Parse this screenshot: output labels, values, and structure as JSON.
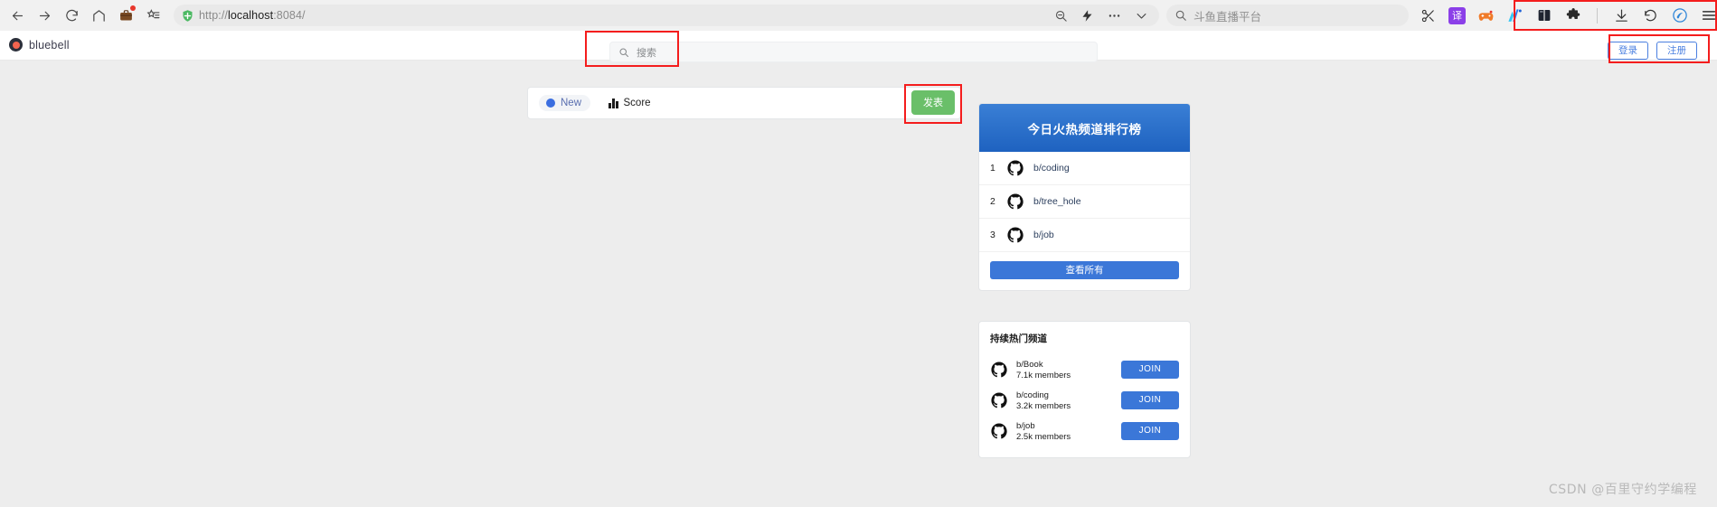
{
  "browser": {
    "nav": [
      {
        "name": "back-icon",
        "label": "Back"
      },
      {
        "name": "forward-icon",
        "label": "Forward"
      },
      {
        "name": "reload-icon",
        "label": "Reload"
      },
      {
        "name": "home-icon",
        "label": "Home"
      },
      {
        "name": "briefcase-icon",
        "label": "Workspace"
      },
      {
        "name": "collections-icon",
        "label": "Collections"
      }
    ],
    "url": {
      "scheme": "http://",
      "host": "localhost",
      "rest": ":8084/"
    },
    "url_icon": "shield-icon",
    "url_actions": [
      {
        "name": "zoom-out-icon",
        "label": "Zoom"
      },
      {
        "name": "flash-icon",
        "label": "Flash"
      },
      {
        "name": "more-icon",
        "label": "More"
      },
      {
        "name": "chevron-down-icon",
        "label": "Expand"
      }
    ],
    "chrome_search": {
      "icon": "search-icon",
      "value": "斗鱼直播平台"
    },
    "extensions": [
      {
        "name": "scissors-icon",
        "label": "Capture"
      },
      {
        "name": "translate-icon",
        "label": "译"
      },
      {
        "name": "game-controller-icon",
        "label": "Games"
      },
      {
        "name": "ai-icon",
        "label": "AI"
      },
      {
        "name": "book-icon",
        "label": "Reading"
      },
      {
        "name": "puzzle-icon",
        "label": "Extensions"
      },
      {
        "name": "download-icon",
        "label": "Downloads"
      },
      {
        "name": "history-back-icon",
        "label": "History"
      },
      {
        "name": "sync-icon",
        "label": "Sync"
      },
      {
        "name": "hamburger-menu-icon",
        "label": "Menu"
      }
    ]
  },
  "site": {
    "brand": "bluebell",
    "search": {
      "placeholder": "搜索",
      "icon": "search-icon"
    },
    "auth": {
      "login": "登录",
      "register": "注册"
    }
  },
  "toolbar": {
    "new_label": "New",
    "score_label": "Score",
    "post_label": "发表"
  },
  "rank_card": {
    "title": "今日火热频道排行榜",
    "rows": [
      {
        "rank": "1",
        "name": "b/coding"
      },
      {
        "rank": "2",
        "name": "b/tree_hole"
      },
      {
        "rank": "3",
        "name": "b/job"
      }
    ],
    "view_all_label": "查看所有"
  },
  "popular_card": {
    "title": "持续热门频道",
    "join_label": "JOIN",
    "rows": [
      {
        "name": "b/Book",
        "members": "7.1k members"
      },
      {
        "name": "b/coding",
        "members": "3.2k members"
      },
      {
        "name": "b/job",
        "members": "2.5k members"
      }
    ]
  },
  "annotations": {
    "color": "#f41d1d",
    "boxes": [
      "site-search",
      "post-button",
      "auth-buttons",
      "browser-extensions"
    ]
  },
  "watermark": "CSDN @百里守约学编程"
}
